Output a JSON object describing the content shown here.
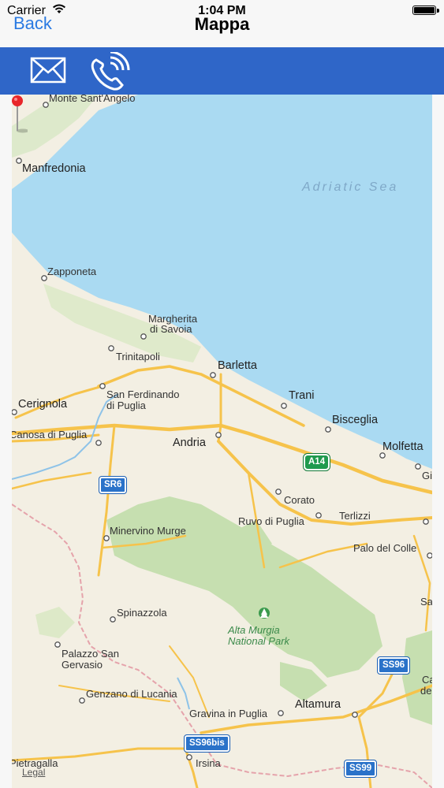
{
  "status_bar": {
    "carrier": "Carrier",
    "time": "1:04 PM"
  },
  "nav": {
    "back_label": "Back",
    "title": "Mappa"
  },
  "toolbar": {
    "mail_icon": "mail-icon",
    "phone_icon": "phone-call-icon"
  },
  "map": {
    "sea_label": "Adriatic Sea",
    "park_label_line1": "Alta Murgia",
    "park_label_line2": "National Park",
    "legal": "Legal",
    "places": {
      "monte_sant_angelo": "Monte Sant'Angelo",
      "manfredonia": "Manfredonia",
      "zapponeta": "Zapponeta",
      "margherita1": "Margherita",
      "margherita2": "di Savoia",
      "trinitapoli": "Trinitapoli",
      "barletta": "Barletta",
      "san_ferdinando1": "San Ferdinando",
      "san_ferdinando2": "di Puglia",
      "trani": "Trani",
      "cerignola": "Cerignola",
      "bisceglia": "Bisceglia",
      "canosa": "Canosa di Puglia",
      "andria": "Andria",
      "molfetta": "Molfetta",
      "gi": "Gi",
      "corato": "Corato",
      "ruvo": "Ruvo di Puglia",
      "terlizzi": "Terlizzi",
      "minervino": "Minervino Murge",
      "palo": "Palo del Colle",
      "sa": "Sa",
      "spinazzola": "Spinazzola",
      "palazzo1": "Palazzo San",
      "palazzo2": "Gervasio",
      "genzano": "Genzano di Lucania",
      "gravina": "Gravina in Puglia",
      "altamura": "Altamura",
      "ca1": "Ca",
      "ca2": "delle",
      "irsina": "Irsina",
      "pietragalla": "Pietragalla"
    },
    "shields": {
      "a14": "A14",
      "sr6": "SR6",
      "ss96": "SS96",
      "ss96bis": "SS96bis",
      "ss99": "SS99"
    },
    "colors": {
      "sea": "#aadaf2",
      "land": "#f3efe3",
      "park": "#c6dfb0",
      "road": "#f6c34b",
      "pin": "#e8262a"
    }
  }
}
